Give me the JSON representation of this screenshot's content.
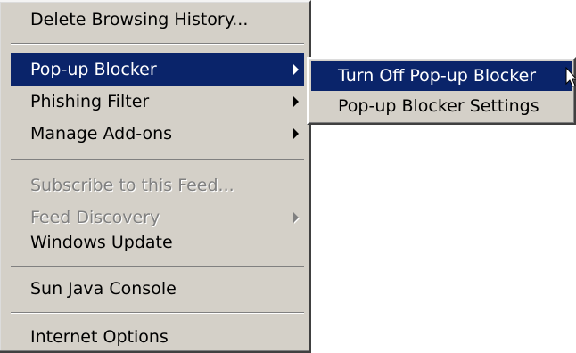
{
  "colors": {
    "menu_bg": "#d4d0c8",
    "highlight_bg": "#0a246a",
    "highlight_text": "#ffffff",
    "disabled_text": "#808080"
  },
  "main_menu": {
    "items": [
      {
        "label": "Delete Browsing History...",
        "state": "normal",
        "has_submenu": false
      },
      {
        "label": "Pop-up Blocker",
        "state": "highlighted",
        "has_submenu": true
      },
      {
        "label": "Phishing Filter",
        "state": "normal",
        "has_submenu": true
      },
      {
        "label": "Manage Add-ons",
        "state": "normal",
        "has_submenu": true
      },
      {
        "label": "Subscribe to this Feed...",
        "state": "disabled",
        "has_submenu": false
      },
      {
        "label": "Feed Discovery",
        "state": "disabled",
        "has_submenu": true
      },
      {
        "label": "Windows Update",
        "state": "normal",
        "has_submenu": false
      },
      {
        "label": "Sun Java Console",
        "state": "normal",
        "has_submenu": false
      },
      {
        "label": "Internet Options",
        "state": "normal",
        "has_submenu": false
      }
    ]
  },
  "submenu": {
    "items": [
      {
        "label": "Turn Off Pop-up Blocker",
        "state": "highlighted"
      },
      {
        "label": "Pop-up Blocker Settings",
        "state": "normal"
      }
    ]
  },
  "icons": {
    "submenu_arrow": "chevron-right-icon",
    "cursor": "mouse-pointer-icon"
  }
}
